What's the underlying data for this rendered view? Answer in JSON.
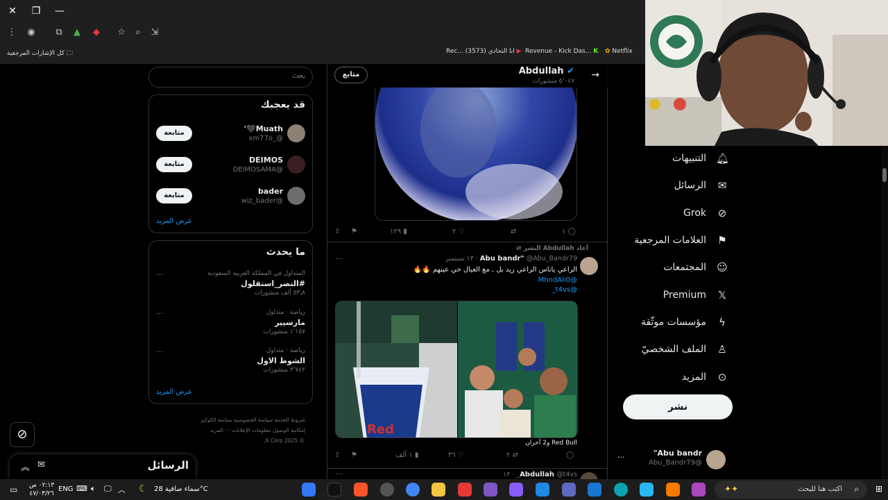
{
  "browser": {
    "bookmarks": {
      "all_bookmarks": "كل الإشارات المرجعية",
      "item1": "Rec... (3573) انا التحادي",
      "item2": "Revenue - Kick Das...",
      "item3": "Netflix"
    }
  },
  "search": {
    "placeholder": "بحث"
  },
  "who_to_follow": {
    "title": "قد يعجبك",
    "follow_label": "متابعة",
    "users": [
      {
        "name": "Muath🖤'",
        "handle": "@_xm77o"
      },
      {
        "name": "DEIMOS",
        "handle": "@DEIMOSAMA"
      },
      {
        "name": "bader",
        "handle": "@wiz_bader"
      }
    ],
    "show_more": "عرض المزيد"
  },
  "trends": {
    "title": "ما يحدث",
    "items": [
      {
        "context": "المتداول في المملكة العربية السعودية",
        "name": "#النصر_استقلول",
        "count": "٥٣٫٨ ألف منشورات"
      },
      {
        "context": "رياضة · متداول",
        "name": "مارسيير",
        "count": "١٬١٥٧ منشورات"
      },
      {
        "context": "رياضة · متداول",
        "name": "الشوط الاول",
        "count": "٣٬٧٤٢ منشورات"
      }
    ],
    "show_more": "عرض المزيد"
  },
  "footer": {
    "line1": "شروط الخدمة   سياسة الخصوصية   سياسة الكوكيز",
    "line2": "إمكانية الوصول   معلومات الإعلانات   ··· المزيد",
    "line3": "© 2025 X Corp."
  },
  "profile_header": {
    "name": "Abdullah",
    "posts_count": "٥٬٠٤٧ منشورات",
    "follow_button": "متابع"
  },
  "tweet1": {
    "replies": "١",
    "likes": "٢",
    "views": "١٢٩"
  },
  "tweet2": {
    "repost_label": "أعاد Abdullah النشر",
    "author": "Abu bandr\"",
    "handle": "@Abu_Bandr79 · ١٣ سبتمبر",
    "text": "الراعي ياناس الراعي ريد بل , مع العيال حي عينهم 🔥🔥",
    "mention1": "@MhndAli0",
    "mention2": "@t4vs_",
    "image_caption": "Red Bull و2 آخران",
    "reposts": "٢",
    "likes": "٣٦",
    "views": "١ ألف"
  },
  "tweet3": {
    "author": "Abdullah",
    "handle": "@t4vs_ · ١٣"
  },
  "nav": {
    "notifications": "التنبيهات",
    "messages": "الرسائل",
    "grok": "Grok",
    "bookmarks": "العلامات المرجعية",
    "communities": "المجتمعات",
    "premium": "Premium",
    "verified_orgs": "مؤسسات موثّقة",
    "profile": "الملف الشخصيّ",
    "more": "المزيد",
    "post_button": "نشر"
  },
  "account": {
    "name": "Abu bandr\"",
    "handle": "@Abu_Bandr79"
  },
  "messages_drawer": {
    "title": "الرسائل"
  },
  "taskbar": {
    "search_placeholder": "اكتب هنا للبحث",
    "weather": "سماء صافية  28°C",
    "lang": "ENG",
    "time": "٠٢:١٣ ص",
    "date": "٤٧/٠٣/٢٦"
  },
  "colors": {
    "background": "#000000",
    "border": "#2f3336",
    "accent": "#1d9bf0",
    "text": "#e7e9ea",
    "muted": "#71767b"
  }
}
